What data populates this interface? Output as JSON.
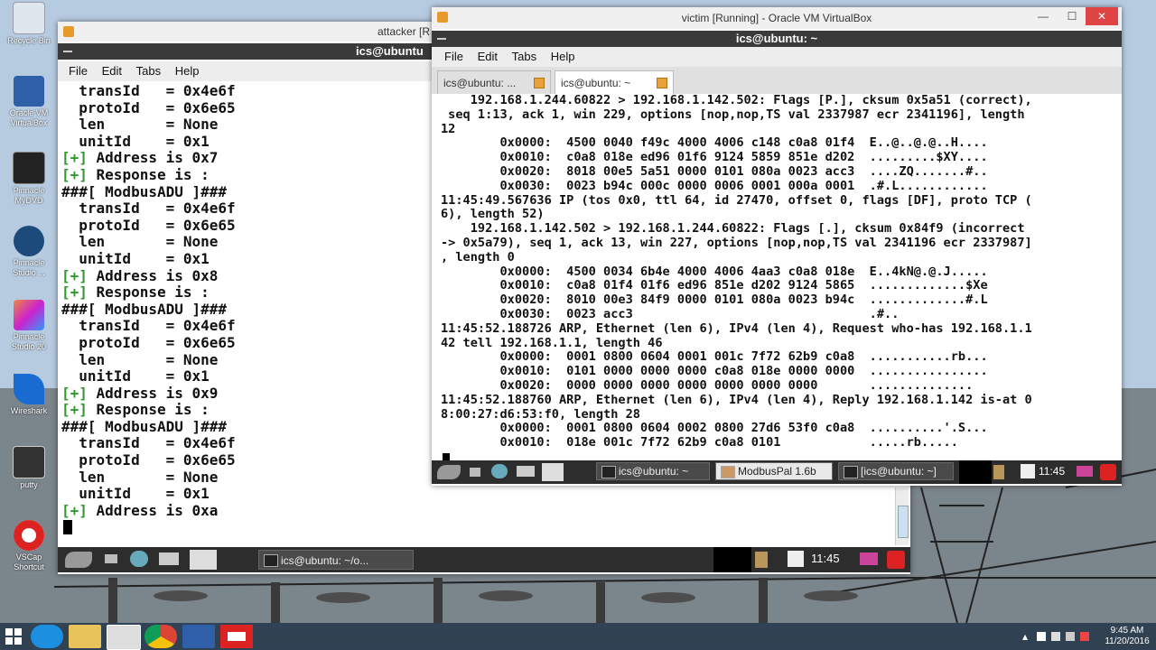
{
  "desktop": {
    "icons": [
      {
        "label": "Recycle Bin"
      },
      {
        "label": "Oracle VM VirtualBox"
      },
      {
        "label": "Pinnacle MyDVD"
      },
      {
        "label": "Pinnacle Studio ..."
      },
      {
        "label": "Pinnacle Studio 20"
      },
      {
        "label": "Wireshark"
      },
      {
        "label": "putty"
      },
      {
        "label": "VSCap Shortcut"
      }
    ]
  },
  "attacker_window": {
    "title": "attacker [R",
    "inner_title": "ics@ubuntu",
    "menu": [
      "File",
      "Edit",
      "Tabs",
      "Help"
    ],
    "lines": [
      {
        "prefix": "",
        "text": "  transId   = 0x4e6f"
      },
      {
        "prefix": "",
        "text": "  protoId   = 0x6e65"
      },
      {
        "prefix": "",
        "text": "  len       = None"
      },
      {
        "prefix": "",
        "text": "  unitId    = 0x1"
      },
      {
        "prefix": "[+]",
        "text": " Address is 0x7"
      },
      {
        "prefix": "[+]",
        "text": " Response is :"
      },
      {
        "prefix": "",
        "text": "###[ ModbusADU ]###"
      },
      {
        "prefix": "",
        "text": "  transId   = 0x4e6f"
      },
      {
        "prefix": "",
        "text": "  protoId   = 0x6e65"
      },
      {
        "prefix": "",
        "text": "  len       = None"
      },
      {
        "prefix": "",
        "text": "  unitId    = 0x1"
      },
      {
        "prefix": "[+]",
        "text": " Address is 0x8"
      },
      {
        "prefix": "[+]",
        "text": " Response is :"
      },
      {
        "prefix": "",
        "text": "###[ ModbusADU ]###"
      },
      {
        "prefix": "",
        "text": "  transId   = 0x4e6f"
      },
      {
        "prefix": "",
        "text": "  protoId   = 0x6e65"
      },
      {
        "prefix": "",
        "text": "  len       = None"
      },
      {
        "prefix": "",
        "text": "  unitId    = 0x1"
      },
      {
        "prefix": "[+]",
        "text": " Address is 0x9"
      },
      {
        "prefix": "[+]",
        "text": " Response is :"
      },
      {
        "prefix": "",
        "text": "###[ ModbusADU ]###"
      },
      {
        "prefix": "",
        "text": "  transId   = 0x4e6f"
      },
      {
        "prefix": "",
        "text": "  protoId   = 0x6e65"
      },
      {
        "prefix": "",
        "text": "  len       = None"
      },
      {
        "prefix": "",
        "text": "  unitId    = 0x1"
      },
      {
        "prefix": "[+]",
        "text": " Address is 0xa"
      }
    ],
    "taskbar_button": "ics@ubuntu: ~/o...",
    "clock": "11:45"
  },
  "victim_window": {
    "title": "victim [Running] - Oracle VM VirtualBox",
    "inner_title": "ics@ubuntu: ~",
    "menu": [
      "File",
      "Edit",
      "Tabs",
      "Help"
    ],
    "tabs": [
      "ics@ubuntu: ...",
      "ics@ubuntu: ~"
    ],
    "lines": [
      "    192.168.1.244.60822 > 192.168.1.142.502: Flags [P.], cksum 0x5a51 (correct),",
      " seq 1:13, ack 1, win 229, options [nop,nop,TS val 2337987 ecr 2341196], length",
      "12",
      "        0x0000:  4500 0040 f49c 4000 4006 c148 c0a8 01f4  E..@..@.@..H....",
      "        0x0010:  c0a8 018e ed96 01f6 9124 5859 851e d202  .........$XY....",
      "        0x0020:  8018 00e5 5a51 0000 0101 080a 0023 acc3  ....ZQ.......#..",
      "        0x0030:  0023 b94c 000c 0000 0006 0001 000a 0001  .#.L............",
      "11:45:49.567636 IP (tos 0x0, ttl 64, id 27470, offset 0, flags [DF], proto TCP (",
      "6), length 52)",
      "    192.168.1.142.502 > 192.168.1.244.60822: Flags [.], cksum 0x84f9 (incorrect",
      "-> 0x5a79), seq 1, ack 13, win 227, options [nop,nop,TS val 2341196 ecr 2337987]",
      ", length 0",
      "        0x0000:  4500 0034 6b4e 4000 4006 4aa3 c0a8 018e  E..4kN@.@.J.....",
      "        0x0010:  c0a8 01f4 01f6 ed96 851e d202 9124 5865  .............$Xe",
      "        0x0020:  8010 00e3 84f9 0000 0101 080a 0023 b94c  .............#.L",
      "        0x0030:  0023 acc3                                .#..",
      "11:45:52.188726 ARP, Ethernet (len 6), IPv4 (len 4), Request who-has 192.168.1.1",
      "42 tell 192.168.1.1, length 46",
      "        0x0000:  0001 0800 0604 0001 001c 7f72 62b9 c0a8  ...........rb...",
      "        0x0010:  0101 0000 0000 0000 c0a8 018e 0000 0000  ................",
      "        0x0020:  0000 0000 0000 0000 0000 0000 0000       ..............",
      "11:45:52.188760 ARP, Ethernet (len 6), IPv4 (len 4), Reply 192.168.1.142 is-at 0",
      "8:00:27:d6:53:f0, length 28",
      "        0x0000:  0001 0800 0604 0002 0800 27d6 53f0 c0a8  ..........'.S...",
      "        0x0010:  018e 001c 7f72 62b9 c0a8 0101            .....rb....."
    ],
    "taskbar_buttons": [
      "ics@ubuntu: ~",
      "ModbusPal 1.6b",
      "[ics@ubuntu: ~]"
    ],
    "clock": "11:45"
  },
  "windows_taskbar": {
    "time": "9:45 AM",
    "date": "11/20/2016"
  },
  "colors": {
    "terminal_green": "#2e9a2e",
    "close_red": "#e04343",
    "vbox_orange": "#e79a2a"
  }
}
